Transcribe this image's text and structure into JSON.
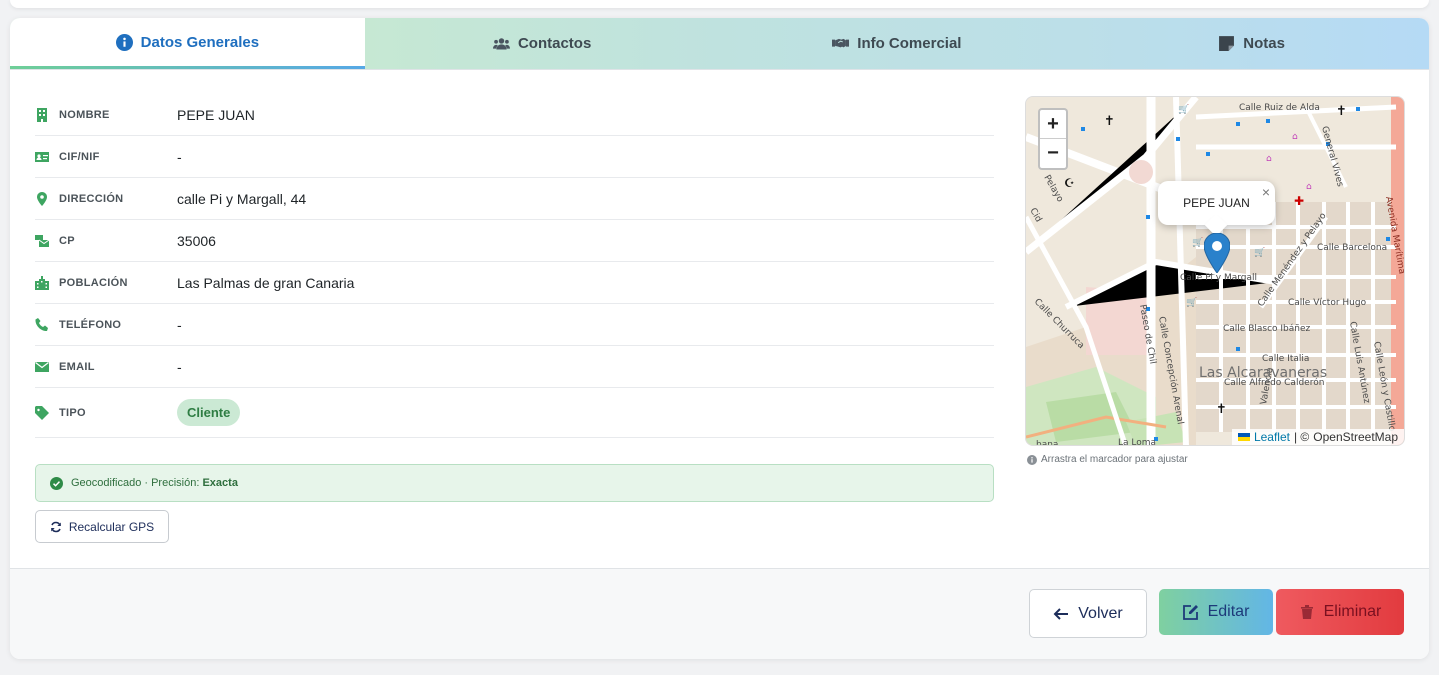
{
  "tabs": [
    {
      "label": "Datos Generales",
      "icon": "info-circle-icon",
      "active": true
    },
    {
      "label": "Contactos",
      "icon": "users-icon",
      "active": false
    },
    {
      "label": "Info Comercial",
      "icon": "handshake-icon",
      "active": false
    },
    {
      "label": "Notas",
      "icon": "note-icon",
      "active": false
    }
  ],
  "fields": [
    {
      "label": "NOMBRE",
      "value": "PEPE JUAN",
      "icon": "building-icon"
    },
    {
      "label": "CIF/NIF",
      "value": "-",
      "icon": "id-card-icon"
    },
    {
      "label": "DIRECCIÓN",
      "value": "calle Pi y Margall, 44",
      "icon": "map-pin-icon"
    },
    {
      "label": "CP",
      "value": "35006",
      "icon": "mail-bulk-icon"
    },
    {
      "label": "POBLACIÓN",
      "value": "Las Palmas de gran Canaria",
      "icon": "city-icon"
    },
    {
      "label": "TELÉFONO",
      "value": "-",
      "icon": "phone-icon"
    },
    {
      "label": "EMAIL",
      "value": "-",
      "icon": "envelope-icon"
    },
    {
      "label": "TIPO",
      "value": "Cliente",
      "icon": "tag-icon"
    }
  ],
  "geocode": {
    "prefix": "Geocodificado · Precisión:",
    "precision": "Exacta"
  },
  "recalc_label": "Recalcular GPS",
  "map": {
    "popup_name": "PEPE JUAN",
    "zoom_in": "+",
    "zoom_out": "−",
    "close": "×",
    "attribution_leaflet": "Leaflet",
    "attribution_sep": "| ©",
    "attribution_osm": "OpenStreetMap",
    "hint": "Arrastra el marcador para ajustar",
    "labels": {
      "ruiz_alda": "Calle Ruiz de Alda",
      "barcelona": "Calle Barcelona",
      "pi_margall": "Calle Pi y Margall",
      "menendez": "Calle Menéndez y Pelayo",
      "victor_hugo": "Calle Víctor Hugo",
      "blasco": "Calle Blasco Ibáñez",
      "luis_antunez": "Calle Luis Antúnez",
      "italia": "Calle Italia",
      "alcaravaneras": "Las Alcaravaneras",
      "alfredo": "Calle Alfredo Calderón",
      "churruca": "Calle Churruca",
      "concepcion": "Calle Concepción Arenal",
      "paseo_chil": "Paseo de Chil",
      "valencia": "Valencia",
      "general_vives": "General Vives",
      "leon_castillo": "Calle León y Castillo",
      "av_maritima": "Avenida Marítima",
      "pelayo": "Pelayo",
      "cid": "Cid",
      "loma": "La Loma",
      "bana": "bana"
    }
  },
  "buttons": {
    "back": "Volver",
    "edit": "Editar",
    "delete": "Eliminar"
  },
  "colors": {
    "accent_green": "#3ea561",
    "accent_blue": "#1f6fbf",
    "danger": "#e23b3f"
  }
}
